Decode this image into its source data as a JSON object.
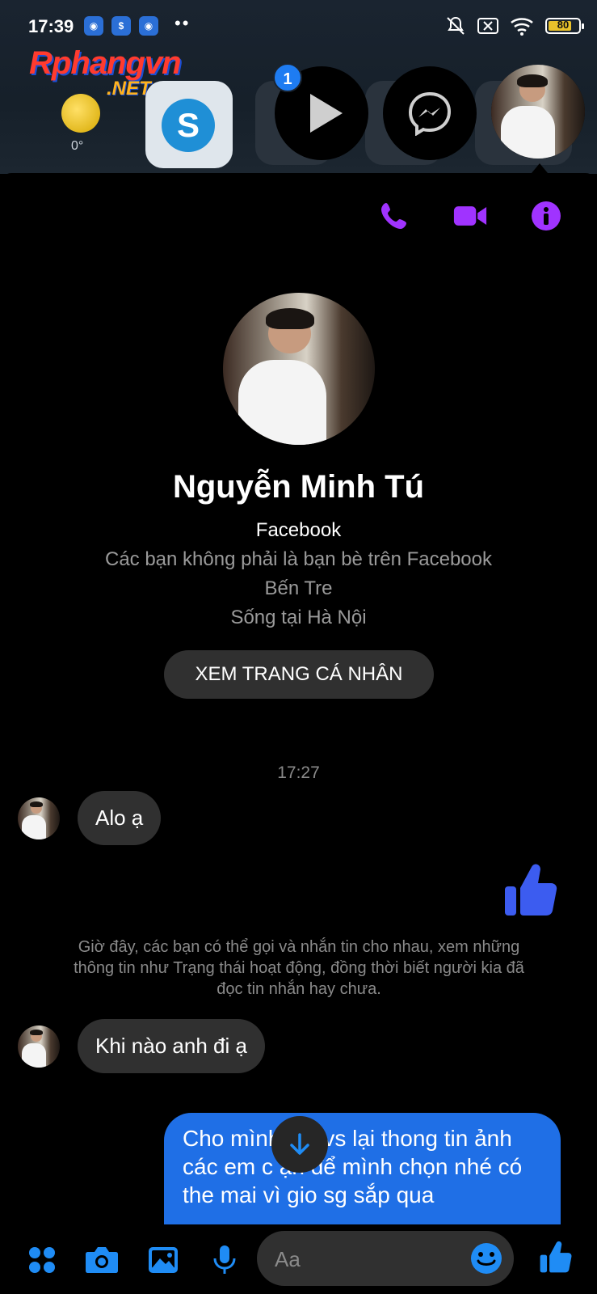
{
  "status_bar": {
    "time": "17:39",
    "battery_level": 80,
    "battery_label": "80",
    "notification_apps": [
      "app-icon",
      "shield-app-icon",
      "app-icon"
    ]
  },
  "watermark": {
    "main": "Rphangvn",
    "sub": ".NET"
  },
  "home_screen": {
    "weather_temp": "0°",
    "skype_letter": "S",
    "chathead_badge": "1"
  },
  "colors": {
    "accent": "#a033ff",
    "brand_blue": "#1f6fe6",
    "like_blue": "#3c5cf0",
    "bubble_gray": "#303030"
  },
  "conversation": {
    "header_actions": [
      "phone-icon",
      "video-icon",
      "info-icon"
    ],
    "contact_name": "Nguyễn Minh Tú",
    "source": "Facebook",
    "relation": "Các bạn không phải là bạn bè trên Facebook",
    "hometown": "Bến Tre",
    "lives_in": "Sống tại Hà Nội",
    "view_profile_label": "XEM TRANG CÁ NHÂN",
    "timestamp": "17:27",
    "messages": {
      "incoming_1": "Alo ạ",
      "system_note": "Giờ đây, các bạn có thể gọi và nhắn tin cho nhau, xem những thông tin như Trạng thái hoạt động, đồng thời biết người kia đã đọc tin nhắn hay chưa.",
      "incoming_2": "Khi nào anh đi ạ",
      "outgoing_1": "Cho mình giá vs lại thong tin ảnh các em c    ạn để mình chọn nhé có the mai vì gio sg sắp qua"
    }
  },
  "composer": {
    "placeholder": "Aa",
    "actions": [
      "menu-icon",
      "camera-icon",
      "gallery-icon",
      "mic-icon"
    ],
    "send_icon": "like-icon"
  }
}
